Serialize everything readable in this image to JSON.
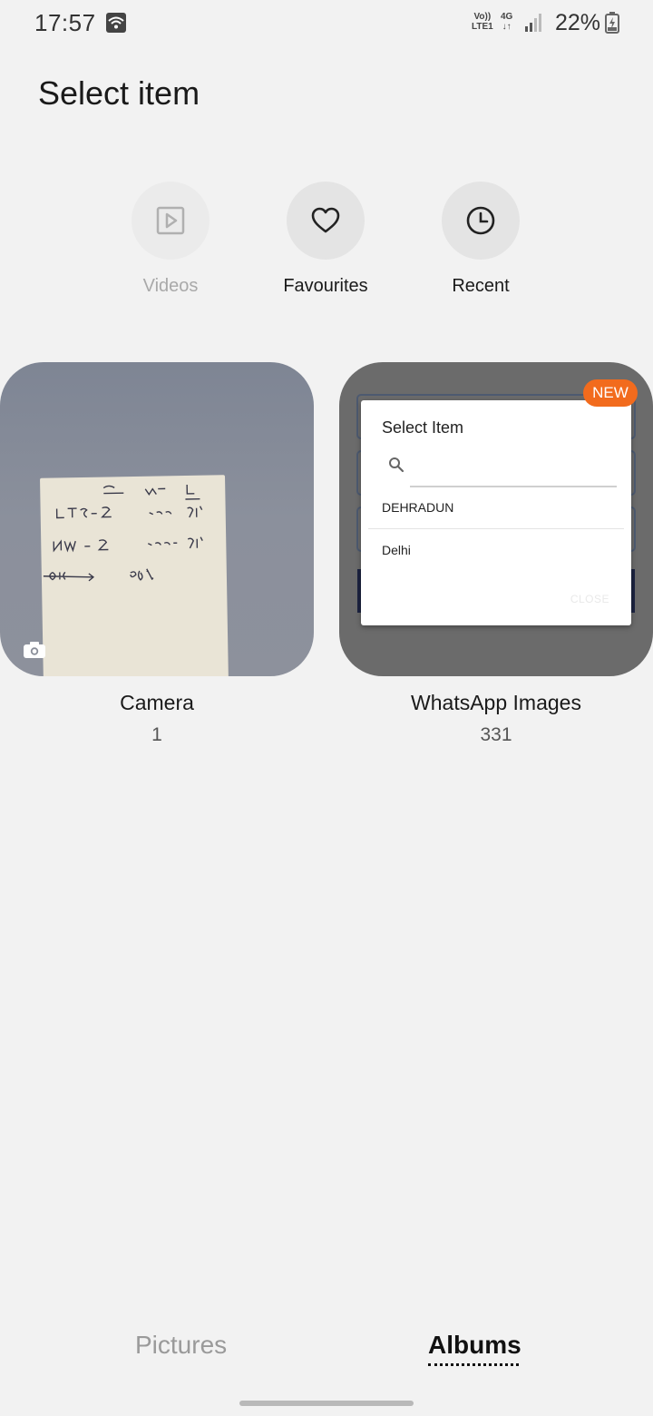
{
  "status_bar": {
    "time": "17:57",
    "volte_top": "Vo))",
    "volte_bottom": "LTE1",
    "network_top": "4G",
    "network_bottom": "↓↑",
    "battery": "22%"
  },
  "header": {
    "title": "Select item"
  },
  "quick_actions": [
    {
      "label": "Videos",
      "icon": "play-icon",
      "enabled": false
    },
    {
      "label": "Favourites",
      "icon": "heart-icon",
      "enabled": true
    },
    {
      "label": "Recent",
      "icon": "clock-icon",
      "enabled": true
    }
  ],
  "albums": [
    {
      "name": "Camera",
      "count": "1"
    },
    {
      "name": "WhatsApp Images",
      "count": "331",
      "badge": "NEW"
    }
  ],
  "whatsapp_preview": {
    "dialog_title": "Select Item",
    "items": [
      "DEHRADUN",
      "Delhi"
    ],
    "close_label": "CLOSE"
  },
  "tabs": [
    {
      "label": "Pictures",
      "active": false
    },
    {
      "label": "Albums",
      "active": true
    }
  ],
  "colors": {
    "background": "#f2f2f2",
    "badge": "#f26b1d",
    "quick_circle": "#e4e4e4"
  }
}
